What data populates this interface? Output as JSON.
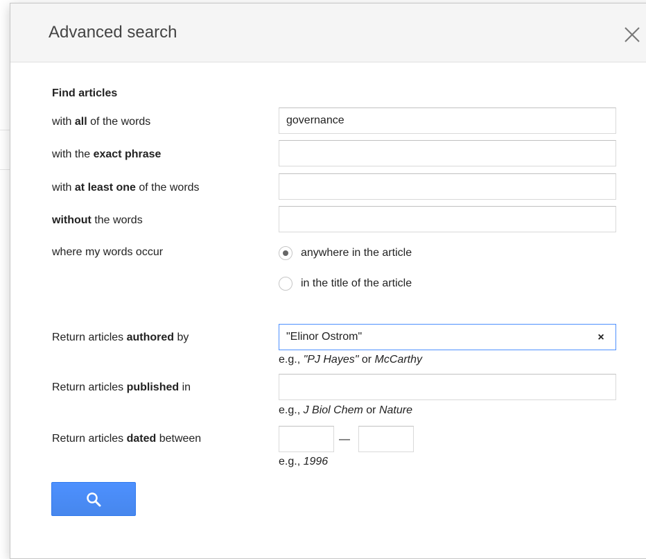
{
  "dialog": {
    "title": "Advanced search",
    "close_icon": "close-icon"
  },
  "find": {
    "section_title": "Find articles",
    "all_words": {
      "label_pre": "with ",
      "label_bold": "all",
      "label_post": " of the words",
      "value": "governance"
    },
    "exact_phrase": {
      "label_pre": "with the ",
      "label_bold": "exact phrase",
      "label_post": "",
      "value": ""
    },
    "at_least_one": {
      "label_pre": "with ",
      "label_bold": "at least one",
      "label_post": " of the words",
      "value": ""
    },
    "without": {
      "label_pre": "",
      "label_bold": "without",
      "label_post": " the words",
      "value": ""
    },
    "occur": {
      "label": "where my words occur",
      "options": [
        {
          "label": "anywhere in the article",
          "checked": true
        },
        {
          "label": "in the title of the article",
          "checked": false
        }
      ]
    }
  },
  "authored": {
    "label_pre": "Return articles ",
    "label_bold": "authored",
    "label_post": " by",
    "value": "\"Elinor Ostrom\"",
    "clear_label": "×",
    "hint_pre": "e.g., ",
    "hint_it1": "\"PJ Hayes\"",
    "hint_mid": " or ",
    "hint_it2": "McCarthy"
  },
  "published": {
    "label_pre": "Return articles ",
    "label_bold": "published",
    "label_post": " in",
    "value": "",
    "hint_pre": "e.g., ",
    "hint_it1": "J Biol Chem",
    "hint_mid": " or ",
    "hint_it2": "Nature"
  },
  "dated": {
    "label_pre": "Return articles ",
    "label_bold": "dated",
    "label_post": " between",
    "from": "",
    "to": "",
    "separator": "—",
    "hint_pre": "e.g., ",
    "hint_it1": "1996"
  },
  "search_button": {
    "icon": "search-icon",
    "color": "#4d90fe"
  }
}
